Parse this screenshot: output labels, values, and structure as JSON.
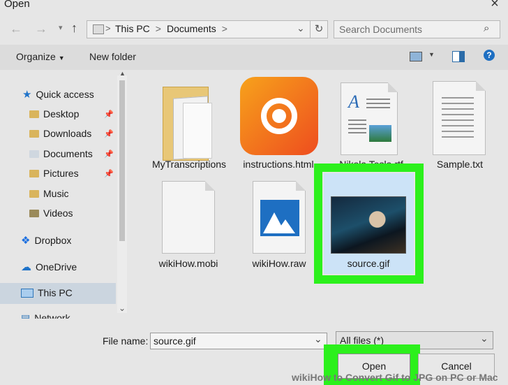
{
  "window": {
    "title": "Open",
    "close": "×"
  },
  "address": {
    "path": [
      "This PC",
      "Documents"
    ],
    "separator": ">"
  },
  "search": {
    "placeholder": "Search Documents"
  },
  "toolbar": {
    "organize": "Organize",
    "new_folder": "New folder"
  },
  "nav": {
    "quick_access": "Quick access",
    "pinned": [
      "Desktop",
      "Downloads",
      "Documents",
      "Pictures"
    ],
    "others": [
      "Music",
      "Videos"
    ],
    "dropbox": "Dropbox",
    "onedrive": "OneDrive",
    "this_pc": "This PC",
    "network": "Network"
  },
  "files": [
    {
      "name": "MyTranscriptions",
      "type": "folder"
    },
    {
      "name": "instructions.html",
      "type": "uc-browser"
    },
    {
      "name": "Nikola Tesla.rtf",
      "type": "rtf"
    },
    {
      "name": "Sample.txt",
      "type": "txt"
    },
    {
      "name": "wikiHow.mobi",
      "type": "blank"
    },
    {
      "name": "wikiHow.raw",
      "type": "image"
    },
    {
      "name": "source.gif",
      "type": "gif",
      "selected": true
    }
  ],
  "bottom": {
    "file_name_label": "File name:",
    "file_name_value": "source.gif",
    "file_type": "All files (*)",
    "open": "Open",
    "cancel": "Cancel"
  },
  "watermark": "wikiHow to Convert Gif to JPG on PC or Mac",
  "colors": {
    "highlight": "#2cf01c",
    "selection": "#cce3f7",
    "accent": "#0078d7"
  }
}
